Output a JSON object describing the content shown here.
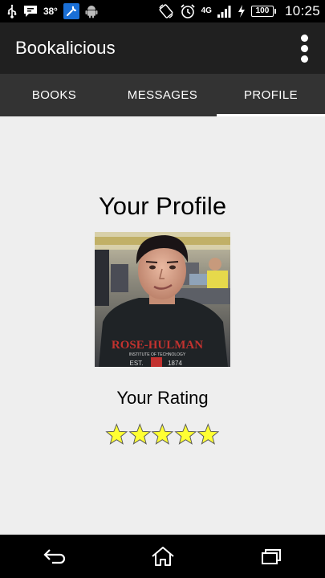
{
  "status_bar": {
    "temperature": "38°",
    "network": "4G",
    "battery": "100",
    "time": "10:25",
    "icons": [
      "usb-icon",
      "message-icon",
      "wrench-icon",
      "android-icon",
      "rotation-icon",
      "alarm-icon",
      "signal-icon",
      "charging-icon"
    ]
  },
  "app_bar": {
    "title": "Bookalicious",
    "overflow_icon": "overflow-menu-icon"
  },
  "tabs": [
    {
      "label": "BOOKS",
      "active": false
    },
    {
      "label": "MESSAGES",
      "active": false
    },
    {
      "label": "PROFILE",
      "active": true
    }
  ],
  "profile": {
    "heading": "Your Profile",
    "photo_shirt_text": "ROSE-HULMAN",
    "photo_shirt_sub": "INSTITUTE OF TECHNOLOGY",
    "photo_shirt_est": "EST.",
    "photo_shirt_year": "1874",
    "rating_label": "Your Rating",
    "rating_value": 5,
    "rating_max": 5,
    "star_color": "#ffff33"
  },
  "nav_bar": {
    "icons": [
      "back-icon",
      "home-icon",
      "recents-icon"
    ]
  }
}
